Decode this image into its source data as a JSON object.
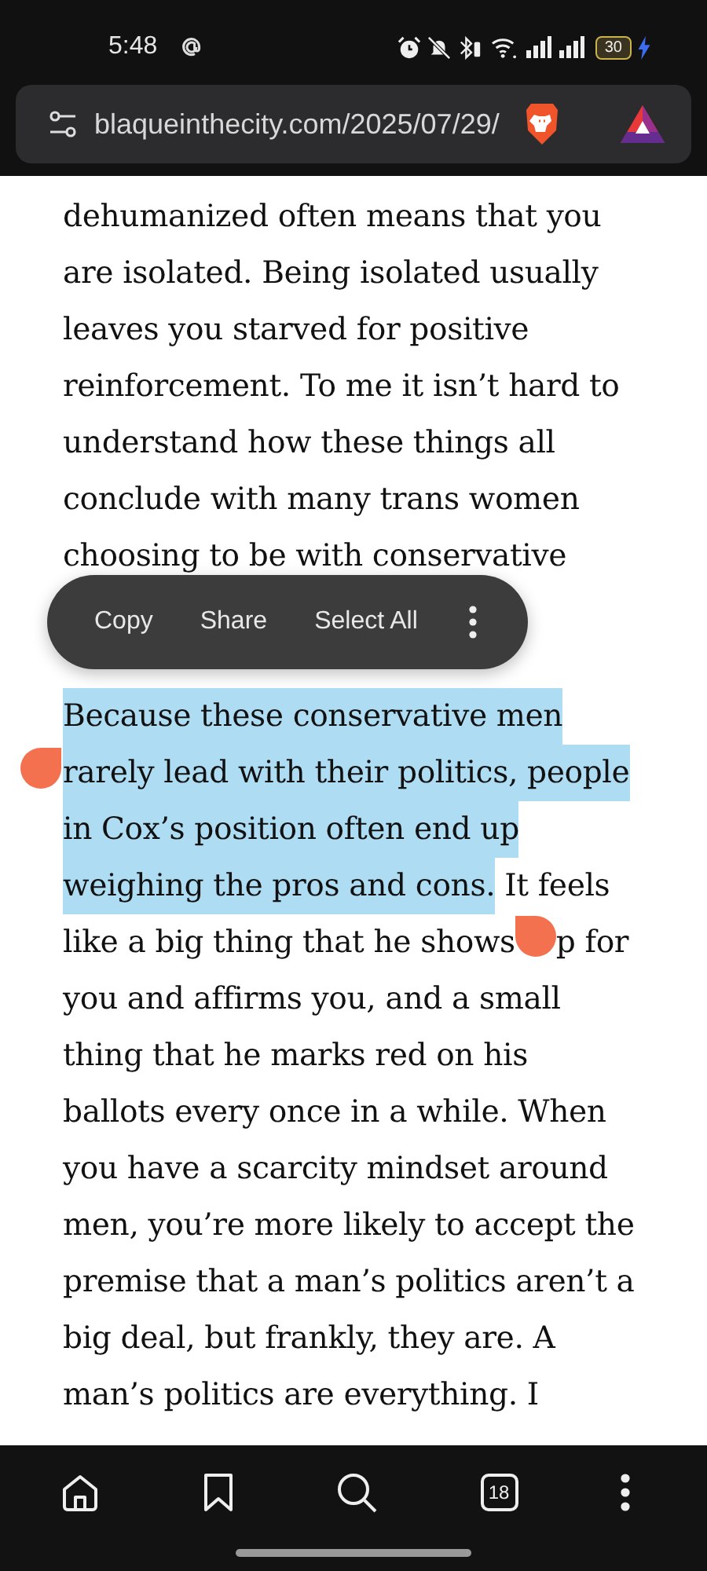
{
  "status_bar": {
    "time": "5:48",
    "battery": "30"
  },
  "address_bar": {
    "url": "blaqueinthecity.com/2025/07/29/"
  },
  "article": {
    "paragraphs": [
      {
        "lines": [
          [
            {
              "text": "dehumanized often means that you",
              "selected": false
            }
          ],
          [
            {
              "text": "are isolated. Being isolated usually",
              "selected": false
            }
          ],
          [
            {
              "text": "leaves you starved for positive",
              "selected": false
            }
          ],
          [
            {
              "text": "reinforcement. To me it isn’t hard to",
              "selected": false
            }
          ],
          [
            {
              "text": "understand how these things all",
              "selected": false
            }
          ],
          [
            {
              "text": "conclude with many trans women",
              "selected": false
            }
          ],
          [
            {
              "text": "choosing to be with conservative",
              "selected": false
            }
          ]
        ]
      },
      {
        "lines": [
          [
            {
              "text": "Because these conservative men",
              "selected": true
            }
          ],
          [
            {
              "text": "rarely lead with their politics, people",
              "selected": true
            }
          ],
          [
            {
              "text": "in Cox’s position often end up",
              "selected": true
            }
          ],
          [
            {
              "text": "weighing the pros and cons.",
              "selected": true
            },
            {
              "text": " It feels",
              "selected": false
            }
          ],
          [
            {
              "text": "like a big thing that he shows",
              "selected": false
            },
            {
              "text": "p for",
              "selected": false,
              "kind": "after_handle"
            }
          ],
          [
            {
              "text": "you and affirms you, and a small",
              "selected": false
            }
          ],
          [
            {
              "text": "thing that he marks red on his",
              "selected": false
            }
          ],
          [
            {
              "text": "ballots every once in a while. When",
              "selected": false
            }
          ],
          [
            {
              "text": "you have a scarcity mindset around",
              "selected": false
            }
          ],
          [
            {
              "text": "men, you’re more likely to accept the",
              "selected": false
            }
          ],
          [
            {
              "text": "premise that a man’s politics aren’t a",
              "selected": false
            }
          ],
          [
            {
              "text": "big deal, but frankly, they are. A",
              "selected": false
            }
          ],
          [
            {
              "text": "man’s politics are everything. I",
              "selected": false
            }
          ]
        ]
      }
    ]
  },
  "selection_menu": {
    "items": [
      "Copy",
      "Share",
      "Select All"
    ]
  },
  "bottom_bar": {
    "tab_count": "18"
  }
}
